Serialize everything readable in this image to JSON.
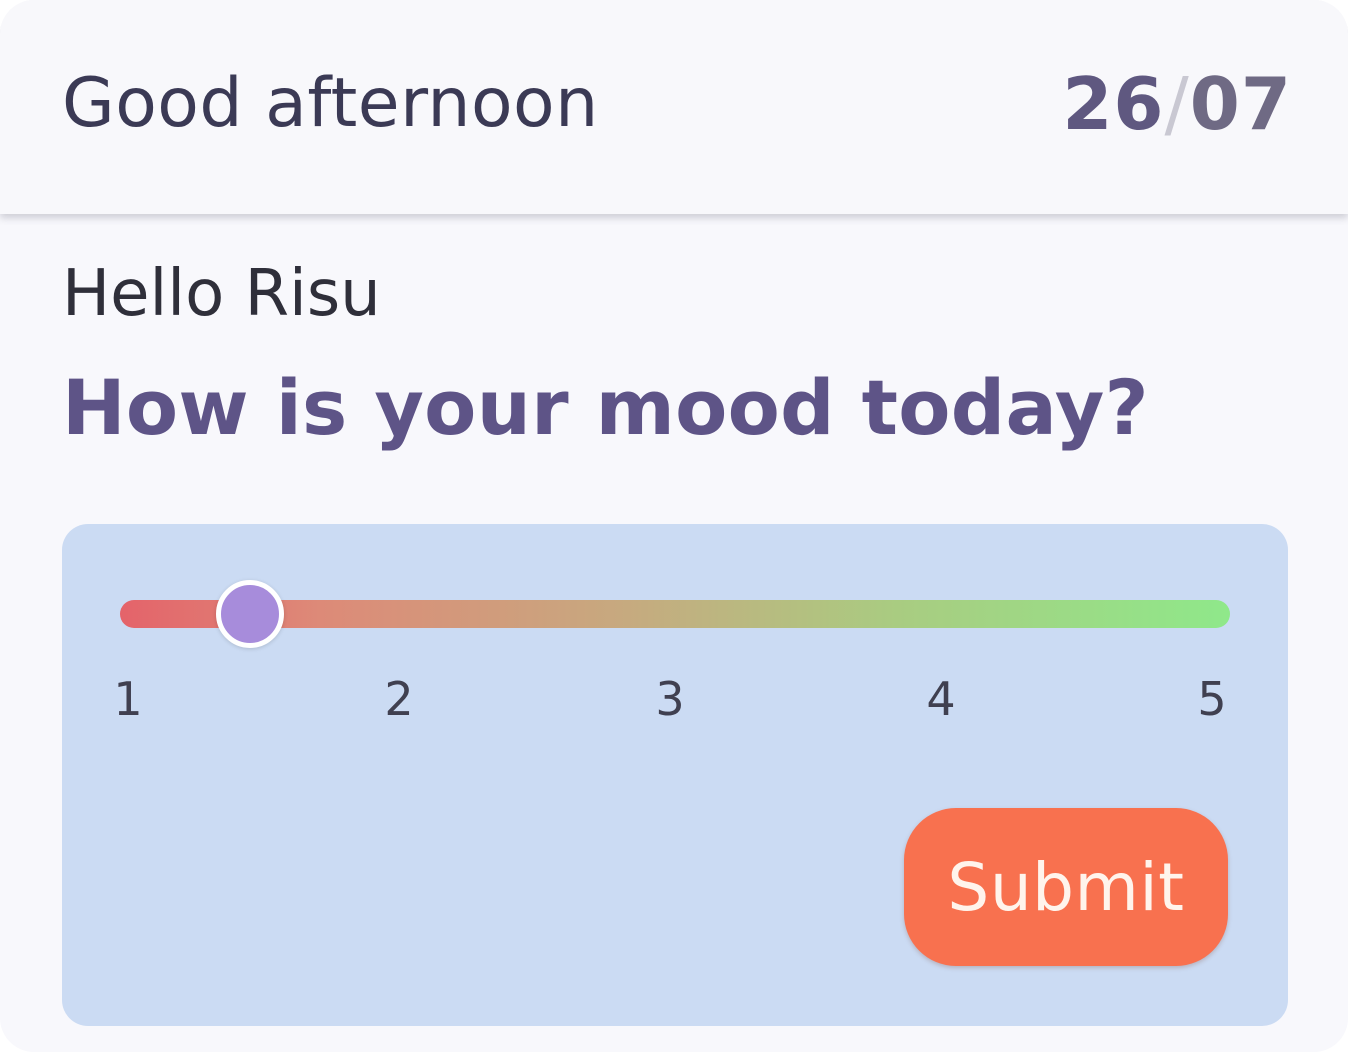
{
  "header": {
    "greeting": "Good afternoon",
    "date_day": "26",
    "date_separator": "/",
    "date_month": "07"
  },
  "main": {
    "hello": "Hello Risu",
    "question": "How is your mood today?"
  },
  "mood_slider": {
    "min": 1,
    "max": 5,
    "value": 1.45,
    "tick_labels": [
      "1",
      "2",
      "3",
      "4",
      "5"
    ],
    "thumb_color": "#a78cdb",
    "gradient_start_color": "#e4636a",
    "gradient_end_color": "#8fe88a"
  },
  "submit": {
    "label": "Submit",
    "color": "#f8714f"
  },
  "colors": {
    "card_background": "#cbdbf3",
    "question_text": "#5e5487"
  }
}
